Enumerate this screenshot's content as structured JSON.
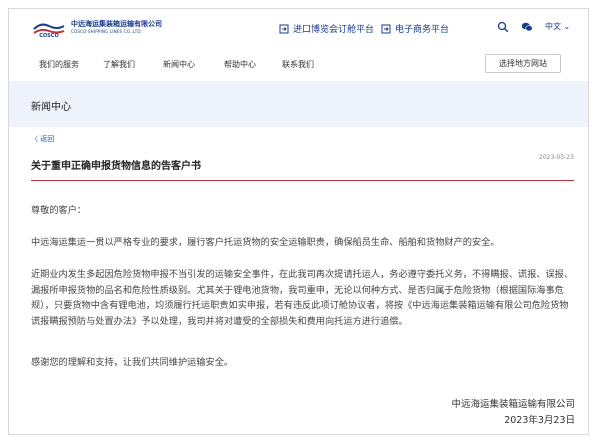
{
  "header": {
    "logo_cn": "中远海运集装箱运输有限公司",
    "logo_en": "COSCO SHIPPING LINES CO.,LTD.",
    "links": [
      "进口博览会订舱平台",
      "电子商务平台"
    ],
    "language": "中文"
  },
  "nav": {
    "items": [
      "我们的服务",
      "了解我们",
      "新闻中心",
      "帮助中心",
      "联系我们"
    ],
    "site_button": "选择地方网站"
  },
  "banner": {
    "title": "新闻中心"
  },
  "article": {
    "back_label": "返回",
    "title": "关于重申正确申报货物信息的告客户书",
    "date": "2023-03-23",
    "paragraphs": [
      "尊敬的客户：",
      "中远海运集运一贯以严格专业的要求，履行客户托运货物的安全运输职责，确保船员生命、船舶和货物财产的安全。",
      "近期业内发生多起因危险货物申报不当引发的运输安全事件，在此我司再次提请托运人，务必遵守委托义务，不得瞒报、谎报、误报、漏报所申报货物的品名和危险性质级别。尤其关于锂电池货物，我司重申，无论以何种方式、是否归属于危险货物（根据国际海事危规），只要货物中含有锂电池，均须履行托运职责如实申报，若有违反此项订舱协议者，将按《中远海运集装箱运输有限公司危险货物谎报瞒报预防与处置办法》予以处理，我司并将对遭受的全部损失和费用向托运方进行追偿。",
      "感谢您的理解和支持，让我们共同维护运输安全。"
    ],
    "signature": "中远海运集装箱运输有限公司",
    "signature_date": "2023年3月23日"
  },
  "colors": {
    "brand": "#1a3a8a",
    "banner": "#eef2fb",
    "divider": "#c0343f"
  },
  "icons": [
    "cosco-logo",
    "login-icon",
    "ecommerce-icon",
    "search-icon",
    "wechat-icon",
    "chevron-down-icon",
    "chevron-left-icon"
  ]
}
